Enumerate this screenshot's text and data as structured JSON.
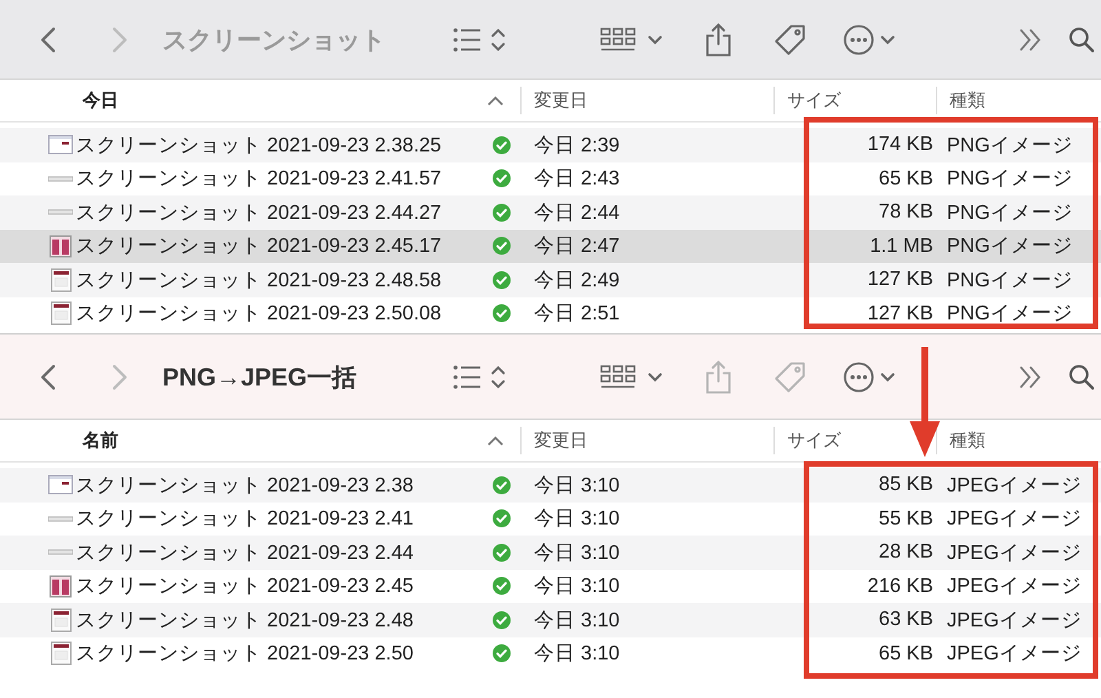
{
  "windows": [
    {
      "title": "スクリーンショット",
      "active": false,
      "share_disabled": false,
      "tag_disabled": false,
      "highlight": true,
      "columns": [
        {
          "label": "今日",
          "sorted": true
        },
        {
          "label": "変更日",
          "sorted": false
        },
        {
          "label": "サイズ",
          "sorted": false
        },
        {
          "label": "種類",
          "sorted": false
        }
      ],
      "rows": [
        {
          "thumbnail": {
            "kind": "dialog"
          },
          "name": "スクリーンショット 2021-09-23 2.38.25",
          "synced": true,
          "date": "今日 2:39",
          "size": "174 KB",
          "file_type": "PNGイメージ",
          "selected": false
        },
        {
          "thumbnail": {
            "kind": "bar"
          },
          "name": "スクリーンショット 2021-09-23 2.41.57",
          "synced": true,
          "date": "今日 2:43",
          "size": "65 KB",
          "file_type": "PNGイメージ",
          "selected": false
        },
        {
          "thumbnail": {
            "kind": "bar"
          },
          "name": "スクリーンショット 2021-09-23 2.44.27",
          "synced": true,
          "date": "今日 2:44",
          "size": "78 KB",
          "file_type": "PNGイメージ",
          "selected": false
        },
        {
          "thumbnail": {
            "kind": "pink"
          },
          "name": "スクリーンショット 2021-09-23 2.45.17",
          "synced": true,
          "date": "今日 2:47",
          "size": "1.1 MB",
          "file_type": "PNGイメージ",
          "selected": true
        },
        {
          "thumbnail": {
            "kind": "doc"
          },
          "name": "スクリーンショット 2021-09-23 2.48.58",
          "synced": true,
          "date": "今日 2:49",
          "size": "127 KB",
          "file_type": "PNGイメージ",
          "selected": false
        },
        {
          "thumbnail": {
            "kind": "doc"
          },
          "name": "スクリーンショット 2021-09-23 2.50.08",
          "synced": true,
          "date": "今日 2:51",
          "size": "127 KB",
          "file_type": "PNGイメージ",
          "selected": false
        }
      ]
    },
    {
      "title": "PNG→JPEG一括",
      "active": true,
      "share_disabled": true,
      "tag_disabled": true,
      "highlight": true,
      "columns": [
        {
          "label": "名前",
          "sorted": true
        },
        {
          "label": "変更日",
          "sorted": false
        },
        {
          "label": "サイズ",
          "sorted": false
        },
        {
          "label": "種類",
          "sorted": false
        }
      ],
      "rows": [
        {
          "thumbnail": {
            "kind": "dialog"
          },
          "name": "スクリーンショット 2021-09-23 2.38",
          "synced": true,
          "date": "今日 3:10",
          "size": "85 KB",
          "file_type": "JPEGイメージ",
          "selected": false
        },
        {
          "thumbnail": {
            "kind": "bar"
          },
          "name": "スクリーンショット 2021-09-23 2.41",
          "synced": true,
          "date": "今日 3:10",
          "size": "55 KB",
          "file_type": "JPEGイメージ",
          "selected": false
        },
        {
          "thumbnail": {
            "kind": "bar"
          },
          "name": "スクリーンショット 2021-09-23 2.44",
          "synced": true,
          "date": "今日 3:10",
          "size": "28 KB",
          "file_type": "JPEGイメージ",
          "selected": false
        },
        {
          "thumbnail": {
            "kind": "pink"
          },
          "name": "スクリーンショット 2021-09-23 2.45",
          "synced": true,
          "date": "今日 3:10",
          "size": "216 KB",
          "file_type": "JPEGイメージ",
          "selected": false
        },
        {
          "thumbnail": {
            "kind": "doc"
          },
          "name": "スクリーンショット 2021-09-23 2.48",
          "synced": true,
          "date": "今日 3:10",
          "size": "63 KB",
          "file_type": "JPEGイメージ",
          "selected": false
        },
        {
          "thumbnail": {
            "kind": "doc"
          },
          "name": "スクリーンショット 2021-09-23 2.50",
          "synced": true,
          "date": "今日 3:10",
          "size": "65 KB",
          "file_type": "JPEGイメージ",
          "selected": false
        }
      ]
    }
  ],
  "arrow_annotation": true
}
